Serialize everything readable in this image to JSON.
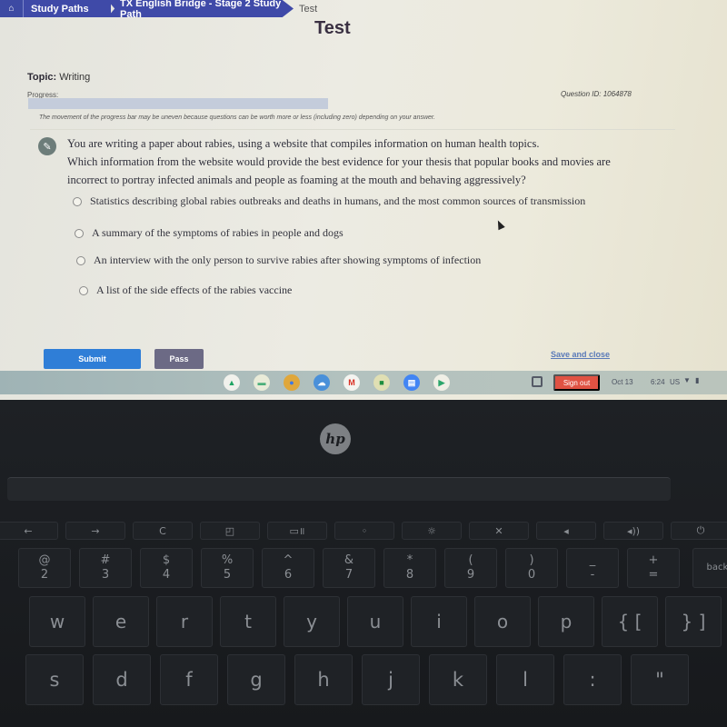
{
  "breadcrumb": {
    "home_icon": "home-icon",
    "items": [
      "Study Paths",
      "TX English Bridge - Stage 2 Study Path"
    ],
    "current": "Test"
  },
  "page": {
    "title": "Test",
    "topic_label": "Topic:",
    "topic_value": "Writing",
    "progress_label": "Progress:",
    "progress_percent": 0,
    "question_id": "Question ID: 1064878",
    "progress_note": "The movement of the progress bar may be uneven because questions can be worth more or less (including zero) depending on your answer."
  },
  "question": {
    "icon": "pencil-icon",
    "prompt_line1": "You are writing a paper about rabies, using a website that compiles information on human health topics.",
    "prompt_line2": "Which information from the website would provide the best evidence for your thesis that popular books and movies are incorrect to portray infected animals and people as foaming at the mouth and behaving aggressively?",
    "options": [
      "Statistics describing global rabies outbreaks and deaths in humans, and the most common sources of transmission",
      "A summary of the symptoms of rabies in people and dogs",
      "An interview with the only person to survive rabies after showing symptoms of infection",
      "A list of the side effects of the rabies vaccine"
    ],
    "selected": null
  },
  "actions": {
    "submit": "Submit",
    "pass": "Pass",
    "save_close": "Save and close"
  },
  "shelf": {
    "apps": [
      {
        "name": "google-drive-icon",
        "glyph": "▲",
        "color": "#1fa463",
        "bg": "#f1f1ec"
      },
      {
        "name": "meet-icon",
        "glyph": "▬",
        "color": "#4caf7a",
        "bg": "#e9ebd8"
      },
      {
        "name": "chrome-icon",
        "glyph": "●",
        "color": "#3b78e7",
        "bg": "#e0a73b"
      },
      {
        "name": "files-icon",
        "glyph": "☁",
        "color": "#ffffff",
        "bg": "#4a90d9"
      },
      {
        "name": "gmail-icon",
        "glyph": "M",
        "color": "#d93025",
        "bg": "#f4f4f0"
      },
      {
        "name": "classroom-icon",
        "glyph": "■",
        "color": "#1e8e3e",
        "bg": "#e0dfb3"
      },
      {
        "name": "docs-icon",
        "glyph": "▤",
        "color": "#ffffff",
        "bg": "#4285f4"
      },
      {
        "name": "play-store-icon",
        "glyph": "▶",
        "color": "#2ba56b",
        "bg": "#f0efe6"
      }
    ],
    "signout": "Sign out",
    "date": "Oct 13",
    "time": "6:24",
    "locale": "US",
    "wifi_icon": "wifi-icon",
    "battery_icon": "battery-icon"
  },
  "laptop": {
    "brand": "hp",
    "fn_keys": [
      "←",
      "→",
      "C",
      "◰",
      "▭॥",
      "◦",
      "☼",
      "✕",
      "◂",
      "◂))",
      "⏻"
    ],
    "num_keys": [
      [
        "@",
        "2"
      ],
      [
        "#",
        "3"
      ],
      [
        "$",
        "4"
      ],
      [
        "%",
        "5"
      ],
      [
        "^",
        "6"
      ],
      [
        "&",
        "7"
      ],
      [
        "*",
        "8"
      ],
      [
        "(",
        "9"
      ],
      [
        ")",
        "0"
      ],
      [
        "_",
        "-"
      ],
      [
        "+",
        "="
      ]
    ],
    "backspace": "backs",
    "row2": [
      "w",
      "e",
      "r",
      "t",
      "y",
      "u",
      "i",
      "o",
      "p",
      "{ [",
      "} ]"
    ],
    "row3": [
      "s",
      "d",
      "f",
      "g",
      "h",
      "j",
      "k",
      "l",
      ":",
      "\""
    ]
  }
}
